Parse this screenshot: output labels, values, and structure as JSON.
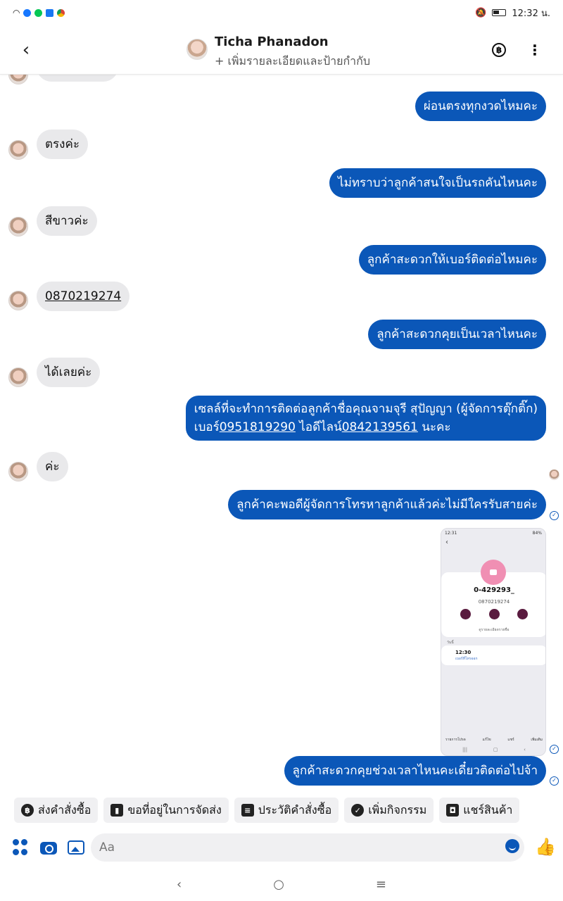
{
  "status_bar": {
    "time": "12:32 น."
  },
  "header": {
    "back_icon": "chevron-left",
    "title": "Ticha Phanadon",
    "subtitle": "+ เพิ่มรายละเอียดและป้ายกำกับ",
    "baht_symbol": "฿",
    "more_icon": "⋮"
  },
  "messages": [
    {
      "dir": "out",
      "text": "ผ่อนตรงทุกงวดไหมคะ"
    },
    {
      "dir": "in",
      "text": "ตรงค่ะ"
    },
    {
      "dir": "out",
      "text": "ไม่ทราบว่าลูกค้าสนใจเป็นรถคันไหนคะ"
    },
    {
      "dir": "in",
      "text": "สีขาวค่ะ"
    },
    {
      "dir": "out",
      "text": "ลูกค้าสะดวกให้เบอร์ติดต่อไหมคะ"
    },
    {
      "dir": "in",
      "text": "0870219274"
    },
    {
      "dir": "out",
      "text": "ลูกค้าสะดวกคุยเป็นเวลาไหนคะ"
    },
    {
      "dir": "in",
      "text": "ได้เลยค่ะ"
    },
    {
      "dir": "out",
      "line1": "เซลล์ที่จะทำการติดต่อลูกค้าชื่อคุณจามจุรี สุปัญญา (ผู้จัดการตุ๊กติ๊ก)",
      "line2_prefix": "เบอร์",
      "phone": "0951819290",
      "mid": " ไอดีไลน์",
      "line_id": "0842139561",
      "suffix": " นะคะ"
    },
    {
      "dir": "in",
      "text": "ค่ะ"
    },
    {
      "dir": "out",
      "text": "ลูกค้าคะพอดีผู้จัดการโทรหาลูกค้าแล้วค่ะไม่มีใครรับสายค่ะ"
    },
    {
      "dir": "out",
      "text": "ลูกค้าสะดวกคุยช่วงเวลาไหนคะเดี๋ยวติดต่อไปจ้า"
    }
  ],
  "shared_image": {
    "status_time": "12:31",
    "status_right": "84%",
    "contact_name": "0-429293_",
    "contact_number": "0870219274",
    "details_link": "ดูรายละเอียดรายชื่อ",
    "section_label": "วันนี้",
    "call_time": "12:30",
    "call_status": "เบอร์ที่โทรออก",
    "footer": [
      "รายการโปรด",
      "แก้ไข",
      "แชร์",
      "เพิ่มเติม"
    ]
  },
  "quick_actions": [
    {
      "icon": "baht-icon",
      "label": "ส่งคำสั่งซื้อ"
    },
    {
      "icon": "map-icon",
      "label": "ขอที่อยู่ในการจัดส่ง"
    },
    {
      "icon": "list-icon",
      "label": "ประวัติคำสั่งซื้อ"
    },
    {
      "icon": "check-icon",
      "label": "เพิ่มกิจกรรม"
    },
    {
      "icon": "shop-icon",
      "label": "แชร์สินค้า"
    }
  ],
  "composer": {
    "placeholder": "Aa"
  },
  "colors": {
    "accent": "#0b57b8",
    "incoming": "#e9e9eb"
  }
}
